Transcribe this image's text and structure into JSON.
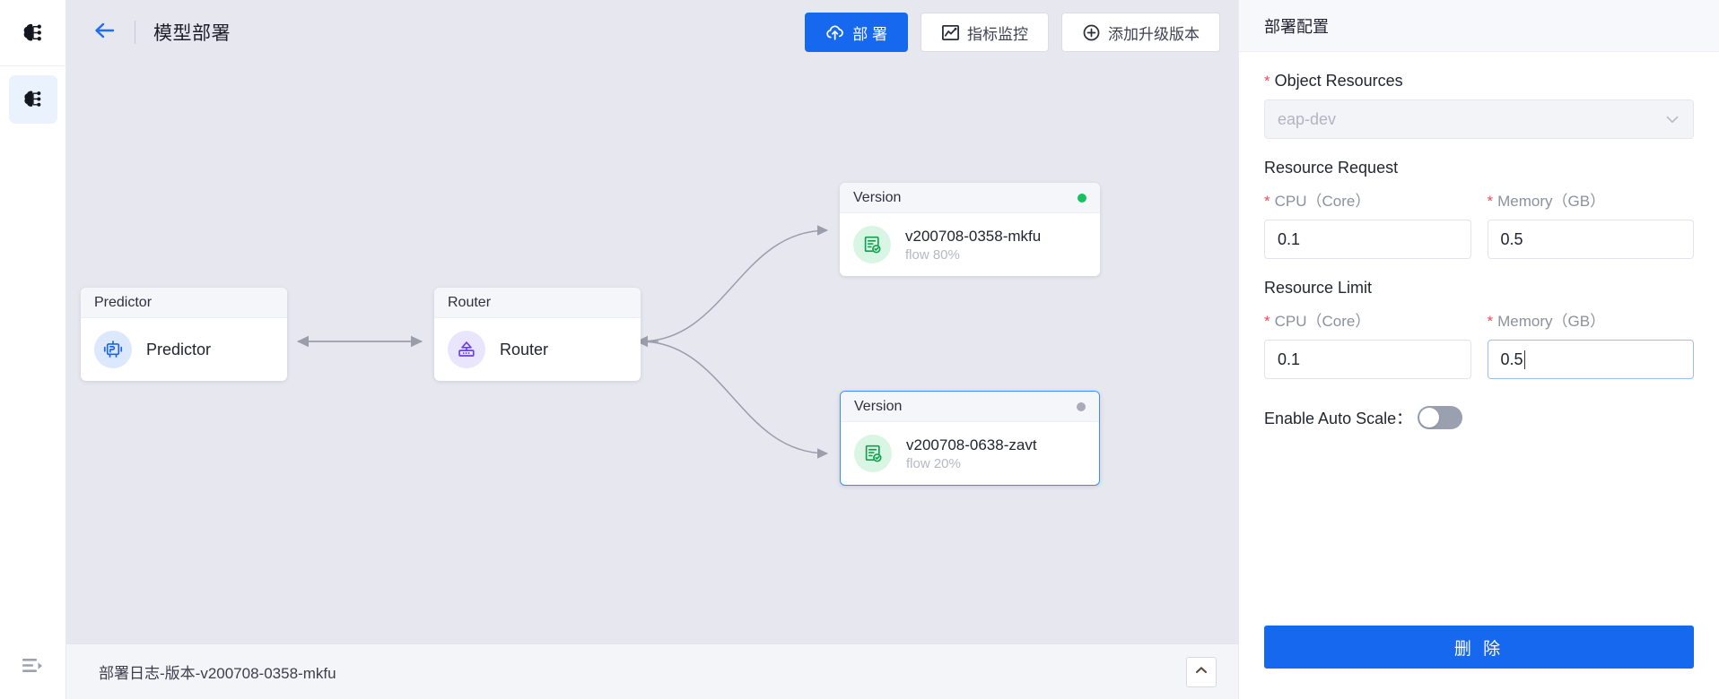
{
  "rail": {
    "items": [
      {
        "name": "brain-icon",
        "active": false
      },
      {
        "name": "brain-icon",
        "active": true
      }
    ],
    "bottom_label": "collapse-sidebar"
  },
  "topbar": {
    "back_label": "back-arrow",
    "title": "模型部署",
    "actions": [
      {
        "label": "部 署",
        "icon": "cloud-upload-icon",
        "style": "primary"
      },
      {
        "label": "指标监控",
        "icon": "chart-monitor-icon",
        "style": "default"
      },
      {
        "label": "添加升级版本",
        "icon": "plus-circle-icon",
        "style": "default"
      }
    ]
  },
  "canvas": {
    "nodes": [
      {
        "id": "predictor",
        "head": "Predictor",
        "title": "Predictor",
        "sub": "",
        "icon": "predictor-icon",
        "avatar_bg": "#dbe8fe",
        "status_dot": "",
        "selected": false
      },
      {
        "id": "router",
        "head": "Router",
        "title": "Router",
        "sub": "",
        "icon": "router-icon",
        "avatar_bg": "#e9e5fd",
        "status_dot": "",
        "selected": false
      },
      {
        "id": "version-top",
        "head": "Version",
        "title": "v200708-0358-mkfu",
        "sub": "flow 80%",
        "icon": "version-check-icon",
        "avatar_bg": "#d9f6e4",
        "status_dot": "#16c25f",
        "selected": false
      },
      {
        "id": "version-bottom",
        "head": "Version",
        "title": "v200708-0638-zavt",
        "sub": "flow 20%",
        "icon": "version-check-icon",
        "avatar_bg": "#d9f6e4",
        "status_dot": "#a9acb8",
        "selected": true
      }
    ]
  },
  "statusbar": {
    "text": "部署日志-版本-v200708-0358-mkfu",
    "collapse_icon": "chevron-up-icon"
  },
  "panel": {
    "title": "部署配置",
    "object_resources": {
      "label": "Object Resources",
      "required": true,
      "value": "eap-dev",
      "placeholder": "eap-dev",
      "chevron": "chevron-down-icon"
    },
    "resource_request": {
      "section": "Resource Request",
      "cpu": {
        "label": "CPU（Core）",
        "required": true,
        "value": "0.1"
      },
      "memory": {
        "label": "Memory（GB）",
        "required": true,
        "value": "0.5"
      }
    },
    "resource_limit": {
      "section": "Resource Limit",
      "cpu": {
        "label": "CPU（Core）",
        "required": true,
        "value": "0.1"
      },
      "memory": {
        "label": "Memory（GB）",
        "required": true,
        "value": "0.5",
        "focused": true
      }
    },
    "auto_scale": {
      "label": "Enable Auto Scale：",
      "enabled": false
    },
    "delete_label": "删 除"
  },
  "colors": {
    "primary": "#1668ef",
    "required": "#f5475c",
    "canvas_bg": "#e6e7ef",
    "status_green": "#16c25f",
    "status_grey": "#a9acb8"
  }
}
